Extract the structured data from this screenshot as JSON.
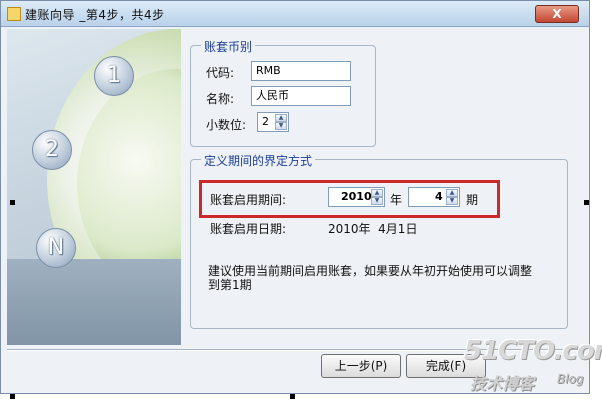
{
  "window": {
    "title": "建账向导 _第4步，共4步",
    "close_glyph": "X"
  },
  "steps": [
    "1",
    "2",
    "N"
  ],
  "currency": {
    "group_title": "账套币别",
    "code_label": "代码:",
    "code_value": "RMB",
    "name_label": "名称:",
    "name_value": "人民币",
    "decimals_label": "小数位:",
    "decimals_value": "2"
  },
  "period": {
    "group_title": "定义期间的界定方式",
    "start_label": "账套启用期间:",
    "year_value": "2010",
    "year_unit": "年",
    "period_value": "4",
    "period_unit": "期",
    "date_label": "账套启用日期:",
    "date_value": "2010年  4月1日",
    "hint": "建议使用当前期间启用账套，如果要从年初开始使用可以调整到第1期"
  },
  "buttons": {
    "prev": "上一步(P)",
    "finish": "完成(F)"
  },
  "watermark": {
    "site": "51CTO.com",
    "tagline": "技术博客",
    "blog": "Blog"
  }
}
